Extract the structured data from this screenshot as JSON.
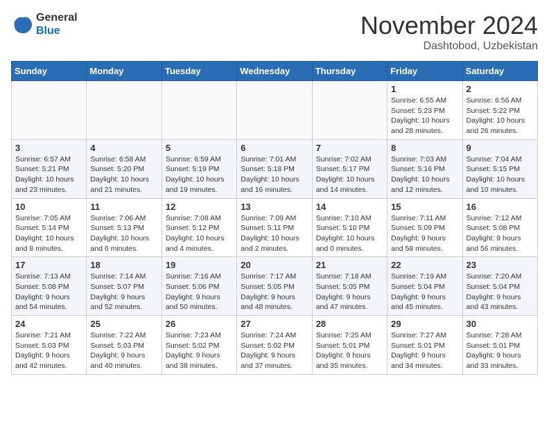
{
  "header": {
    "logo_line1": "General",
    "logo_line2": "Blue",
    "month": "November 2024",
    "location": "Dashtobod, Uzbekistan"
  },
  "days_of_week": [
    "Sunday",
    "Monday",
    "Tuesday",
    "Wednesday",
    "Thursday",
    "Friday",
    "Saturday"
  ],
  "weeks": [
    [
      {
        "day": "",
        "info": ""
      },
      {
        "day": "",
        "info": ""
      },
      {
        "day": "",
        "info": ""
      },
      {
        "day": "",
        "info": ""
      },
      {
        "day": "",
        "info": ""
      },
      {
        "day": "1",
        "info": "Sunrise: 6:55 AM\nSunset: 5:23 PM\nDaylight: 10 hours\nand 28 minutes."
      },
      {
        "day": "2",
        "info": "Sunrise: 6:56 AM\nSunset: 5:22 PM\nDaylight: 10 hours\nand 26 minutes."
      }
    ],
    [
      {
        "day": "3",
        "info": "Sunrise: 6:57 AM\nSunset: 5:21 PM\nDaylight: 10 hours\nand 23 minutes."
      },
      {
        "day": "4",
        "info": "Sunrise: 6:58 AM\nSunset: 5:20 PM\nDaylight: 10 hours\nand 21 minutes."
      },
      {
        "day": "5",
        "info": "Sunrise: 6:59 AM\nSunset: 5:19 PM\nDaylight: 10 hours\nand 19 minutes."
      },
      {
        "day": "6",
        "info": "Sunrise: 7:01 AM\nSunset: 5:18 PM\nDaylight: 10 hours\nand 16 minutes."
      },
      {
        "day": "7",
        "info": "Sunrise: 7:02 AM\nSunset: 5:17 PM\nDaylight: 10 hours\nand 14 minutes."
      },
      {
        "day": "8",
        "info": "Sunrise: 7:03 AM\nSunset: 5:16 PM\nDaylight: 10 hours\nand 12 minutes."
      },
      {
        "day": "9",
        "info": "Sunrise: 7:04 AM\nSunset: 5:15 PM\nDaylight: 10 hours\nand 10 minutes."
      }
    ],
    [
      {
        "day": "10",
        "info": "Sunrise: 7:05 AM\nSunset: 5:14 PM\nDaylight: 10 hours\nand 8 minutes."
      },
      {
        "day": "11",
        "info": "Sunrise: 7:06 AM\nSunset: 5:13 PM\nDaylight: 10 hours\nand 6 minutes."
      },
      {
        "day": "12",
        "info": "Sunrise: 7:08 AM\nSunset: 5:12 PM\nDaylight: 10 hours\nand 4 minutes."
      },
      {
        "day": "13",
        "info": "Sunrise: 7:09 AM\nSunset: 5:11 PM\nDaylight: 10 hours\nand 2 minutes."
      },
      {
        "day": "14",
        "info": "Sunrise: 7:10 AM\nSunset: 5:10 PM\nDaylight: 10 hours\nand 0 minutes."
      },
      {
        "day": "15",
        "info": "Sunrise: 7:11 AM\nSunset: 5:09 PM\nDaylight: 9 hours\nand 58 minutes."
      },
      {
        "day": "16",
        "info": "Sunrise: 7:12 AM\nSunset: 5:08 PM\nDaylight: 9 hours\nand 56 minutes."
      }
    ],
    [
      {
        "day": "17",
        "info": "Sunrise: 7:13 AM\nSunset: 5:08 PM\nDaylight: 9 hours\nand 54 minutes."
      },
      {
        "day": "18",
        "info": "Sunrise: 7:14 AM\nSunset: 5:07 PM\nDaylight: 9 hours\nand 52 minutes."
      },
      {
        "day": "19",
        "info": "Sunrise: 7:16 AM\nSunset: 5:06 PM\nDaylight: 9 hours\nand 50 minutes."
      },
      {
        "day": "20",
        "info": "Sunrise: 7:17 AM\nSunset: 5:05 PM\nDaylight: 9 hours\nand 48 minutes."
      },
      {
        "day": "21",
        "info": "Sunrise: 7:18 AM\nSunset: 5:05 PM\nDaylight: 9 hours\nand 47 minutes."
      },
      {
        "day": "22",
        "info": "Sunrise: 7:19 AM\nSunset: 5:04 PM\nDaylight: 9 hours\nand 45 minutes."
      },
      {
        "day": "23",
        "info": "Sunrise: 7:20 AM\nSunset: 5:04 PM\nDaylight: 9 hours\nand 43 minutes."
      }
    ],
    [
      {
        "day": "24",
        "info": "Sunrise: 7:21 AM\nSunset: 5:03 PM\nDaylight: 9 hours\nand 42 minutes."
      },
      {
        "day": "25",
        "info": "Sunrise: 7:22 AM\nSunset: 5:03 PM\nDaylight: 9 hours\nand 40 minutes."
      },
      {
        "day": "26",
        "info": "Sunrise: 7:23 AM\nSunset: 5:02 PM\nDaylight: 9 hours\nand 38 minutes."
      },
      {
        "day": "27",
        "info": "Sunrise: 7:24 AM\nSunset: 5:02 PM\nDaylight: 9 hours\nand 37 minutes."
      },
      {
        "day": "28",
        "info": "Sunrise: 7:25 AM\nSunset: 5:01 PM\nDaylight: 9 hours\nand 35 minutes."
      },
      {
        "day": "29",
        "info": "Sunrise: 7:27 AM\nSunset: 5:01 PM\nDaylight: 9 hours\nand 34 minutes."
      },
      {
        "day": "30",
        "info": "Sunrise: 7:28 AM\nSunset: 5:01 PM\nDaylight: 9 hours\nand 33 minutes."
      }
    ]
  ]
}
